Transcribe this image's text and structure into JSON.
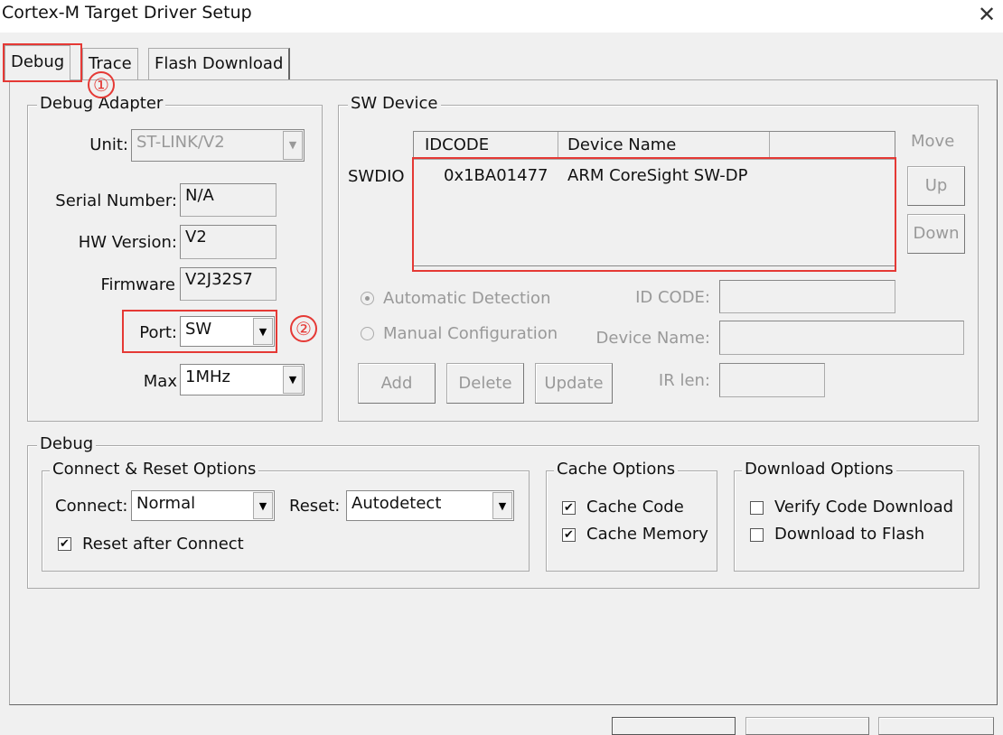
{
  "window": {
    "title": "Cortex-M Target Driver Setup",
    "close": "✕"
  },
  "tabs": [
    {
      "label": "Debug",
      "selected": true
    },
    {
      "label": "Trace"
    },
    {
      "label": "Flash Download"
    }
  ],
  "annotations": {
    "one": "①",
    "two": "②",
    "accent": "#e53935"
  },
  "adapter": {
    "title": "Debug Adapter",
    "unit_label": "Unit:",
    "unit_value": "ST-LINK/V2",
    "serial_label": "Serial Number:",
    "serial_value": "N/A",
    "hw_label": "HW Version:",
    "hw_value": "V2",
    "fw_label": "Firmware",
    "fw_value": "V2J32S7",
    "port_label": "Port:",
    "port_value": "SW",
    "max_label": "Max",
    "max_value": "1MHz"
  },
  "sw": {
    "title": "SW Device",
    "swdio": "SWDIO",
    "columns": [
      "IDCODE",
      "Device Name"
    ],
    "rows": [
      {
        "idcode": "0x1BA01477",
        "name": "ARM CoreSight SW-DP"
      }
    ],
    "move": "Move",
    "up": "Up",
    "down": "Down",
    "auto": "Automatic Detection",
    "manual": "Manual Configuration",
    "idcode_label": "ID CODE:",
    "devname_label": "Device Name:",
    "irlen_label": "IR len:",
    "add": "Add",
    "delete": "Delete",
    "update": "Update"
  },
  "debug": {
    "title": "Debug",
    "connect_reset": {
      "title": "Connect & Reset Options",
      "connect_label": "Connect:",
      "connect_value": "Normal",
      "reset_label": "Reset:",
      "reset_value": "Autodetect",
      "reset_after": "Reset after Connect",
      "reset_after_checked": true
    },
    "cache": {
      "title": "Cache Options",
      "code": "Cache Code",
      "code_checked": true,
      "memory": "Cache Memory",
      "memory_checked": true
    },
    "download": {
      "title": "Download Options",
      "verify": "Verify Code Download",
      "verify_checked": false,
      "flash": "Download to Flash",
      "flash_checked": false
    }
  }
}
